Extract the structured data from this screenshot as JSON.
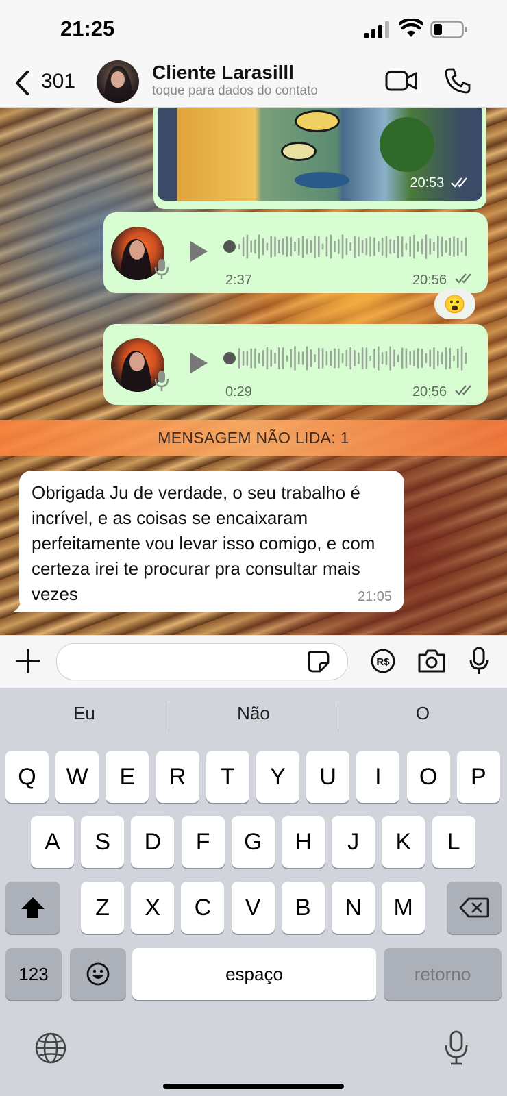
{
  "status_bar": {
    "time": "21:25"
  },
  "header": {
    "back_count": "301",
    "contact_name": "Cliente Larasilll",
    "contact_subtitle": "toque para dados do contato"
  },
  "chat": {
    "image_message": {
      "time": "20:53"
    },
    "voice_messages": [
      {
        "duration": "2:37",
        "time": "20:56",
        "reaction": "😮"
      },
      {
        "duration": "0:29",
        "time": "20:56"
      }
    ],
    "unread_banner": "MENSAGEM NÃO LIDA: 1",
    "incoming_message": {
      "text": "Obrigada Ju de verdade, o seu trabalho é incrível, e as coisas se encaixaram perfeitamente vou levar isso comigo, e com certeza irei te procurar pra consultar mais vezes",
      "time": "21:05"
    }
  },
  "input": {
    "placeholder": ""
  },
  "keyboard": {
    "suggestions": [
      "Eu",
      "Não",
      "O"
    ],
    "row1": [
      "Q",
      "W",
      "E",
      "R",
      "T",
      "Y",
      "U",
      "I",
      "O",
      "P"
    ],
    "row2": [
      "A",
      "S",
      "D",
      "F",
      "G",
      "H",
      "J",
      "K",
      "L"
    ],
    "row3": [
      "Z",
      "X",
      "C",
      "V",
      "B",
      "N",
      "M"
    ],
    "numbers_key": "123",
    "space_key": "espaço",
    "return_key": "retorno"
  },
  "colors": {
    "outgoing_bubble": "#d9fdd3",
    "incoming_bubble": "#ffffff",
    "unread_bar": "#f79a5a"
  }
}
